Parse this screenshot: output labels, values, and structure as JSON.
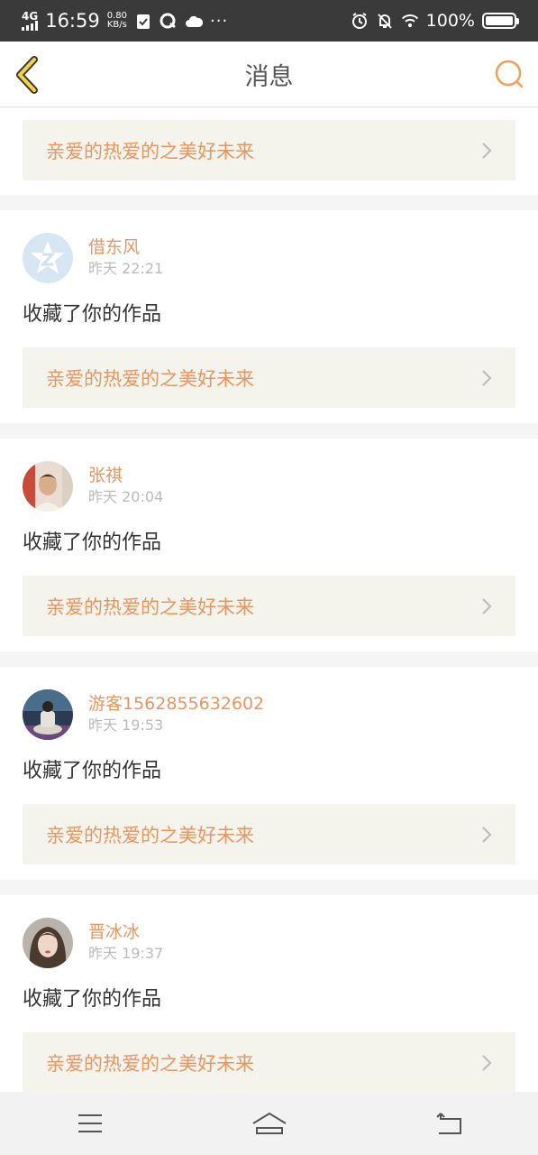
{
  "status_bar": {
    "network": "4G",
    "time": "16:59",
    "speed_value": "0.80",
    "speed_unit": "KB/s",
    "dots": "···",
    "battery": "100%"
  },
  "header": {
    "title": "消息",
    "back_icon": "back-chevron-icon",
    "search_icon": "search-icon",
    "accent_color": "#f0a05a"
  },
  "top_item": {
    "work_title": "亲爱的热爱的之美好未来"
  },
  "messages": [
    {
      "username": "借东风",
      "time": "昨天 22:21",
      "action": "收藏了你的作品",
      "work_title": "亲爱的热爱的之美好未来",
      "avatar": "default-z-avatar"
    },
    {
      "username": "张祺",
      "time": "昨天 20:04",
      "action": "收藏了你的作品",
      "work_title": "亲爱的热爱的之美好未来",
      "avatar": "photo-avatar"
    },
    {
      "username": "游客1562855632602",
      "time": "昨天 19:53",
      "action": "收藏了你的作品",
      "work_title": "亲爱的热爱的之美好未来",
      "avatar": "photo-avatar"
    },
    {
      "username": "晋冰冰",
      "time": "昨天 19:37",
      "action": "收藏了你的作品",
      "work_title": "亲爱的热爱的之美好未来",
      "avatar": "photo-avatar"
    }
  ],
  "nav_bar": {
    "menu_icon": "menu-icon",
    "home_icon": "home-icon",
    "back_icon": "back-arrow-icon"
  }
}
